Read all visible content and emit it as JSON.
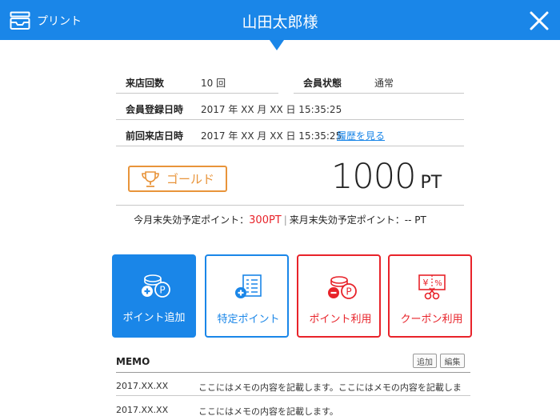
{
  "header": {
    "print_label": "プリント",
    "title": "山田太郎様"
  },
  "info": {
    "visits": {
      "label": "来店回数",
      "value": "10 回"
    },
    "status": {
      "label": "会員状態",
      "value": "通常"
    },
    "registered": {
      "label": "会員登録日時",
      "value": "2017 年 XX 月 XX 日 15:35:25"
    },
    "last_visit": {
      "label": "前回来店日時",
      "value": "2017 年 XX 月 XX 日 15:35:25",
      "link": "履歴を見る"
    }
  },
  "rank": {
    "label": "ゴールド"
  },
  "points": {
    "value": "1000",
    "unit": "PT"
  },
  "expire": {
    "this_month_label": "今月末失効予定ポイント：",
    "this_month_value": "300PT",
    "separator": "|",
    "next_month_label": "来月末失効予定ポイント：-- PT"
  },
  "actions": [
    {
      "label": "ポイント追加",
      "icon": "coin-add-icon"
    },
    {
      "label": "特定ポイント",
      "icon": "list-add-icon"
    },
    {
      "label": "ポイント利用",
      "icon": "coin-minus-icon"
    },
    {
      "label": "クーポン利用",
      "icon": "coupon-scissors-icon"
    }
  ],
  "memo": {
    "title": "MEMO",
    "add_label": "追加",
    "edit_label": "編集",
    "rows": [
      {
        "date": "2017.XX.XX",
        "text": "ここにはメモの内容を記載します。ここにはメモの内容を記載しま"
      },
      {
        "date": "2017.XX.XX",
        "text": "ここにはメモの内容を記載します。"
      }
    ]
  },
  "colors": {
    "primary": "#1a86e8",
    "danger": "#e8232a",
    "gold": "#e8943a"
  }
}
